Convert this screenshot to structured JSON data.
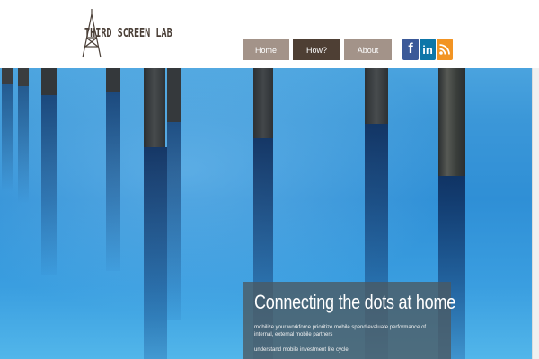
{
  "logo": {
    "text": "THIRD SCREEN LAB"
  },
  "nav": {
    "items": [
      {
        "label": "Home"
      },
      {
        "label": "How?"
      },
      {
        "label": "About"
      }
    ]
  },
  "social": {
    "facebook": "f",
    "linkedin": "in"
  },
  "colors": {
    "nav_inactive": "#a39389",
    "nav_active": "#4e3f34",
    "hero_blue": "#2f8fd6",
    "caption_bg": "#4b5860"
  },
  "caption": {
    "title": "Connecting the dots at home",
    "line1": "mobilize your workforce prioritize mobile spend evaluate performance of internal, external mobile partners",
    "line2": "understand mobile investment life cycle"
  }
}
